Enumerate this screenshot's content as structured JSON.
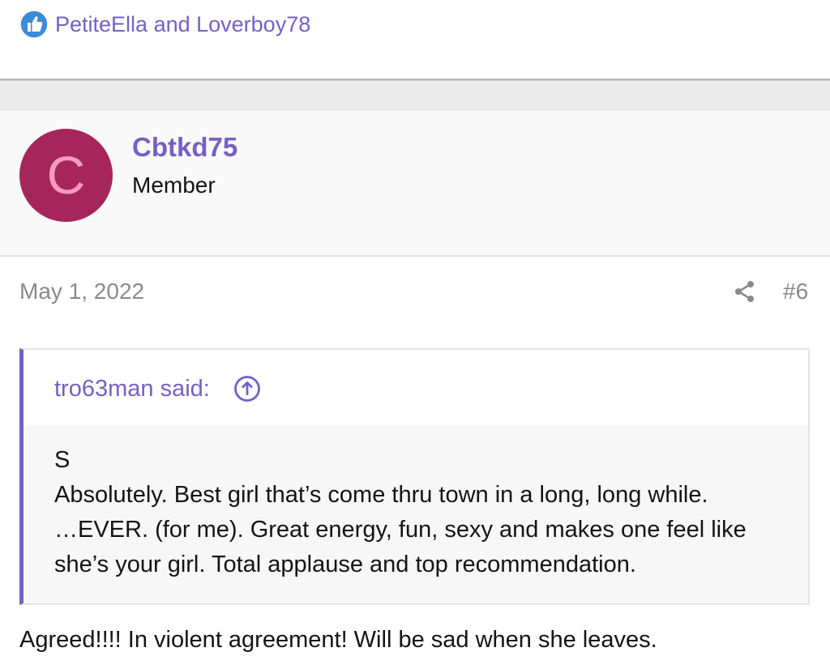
{
  "reactions": {
    "icon": "thumbs-up-icon",
    "icon_color": "#3b8cd6",
    "users_text": "PetiteElla and Loverboy78"
  },
  "post": {
    "author": {
      "avatar_letter": "C",
      "avatar_color": "#a6265c",
      "username": "Cbtkd75",
      "title": "Member"
    },
    "date": "May 1, 2022",
    "share_icon": "share-icon",
    "number": "#6",
    "quote": {
      "author_text": "tro63man said:",
      "jump_icon": "arrow-up-circle-icon",
      "lines": [
        "S",
        "Absolutely. Best girl that’s come thru town in a long, long while.",
        "…EVER. (for me). Great energy, fun, sexy and makes one feel like",
        "she’s your girl. Total applause and top recommendation."
      ]
    },
    "reply_text": "Agreed!!!! In violent agreement! Will be sad when she leaves."
  },
  "colors": {
    "accent": "#7461c4",
    "muted_text": "#8a8a8a",
    "body_text": "#141414"
  }
}
